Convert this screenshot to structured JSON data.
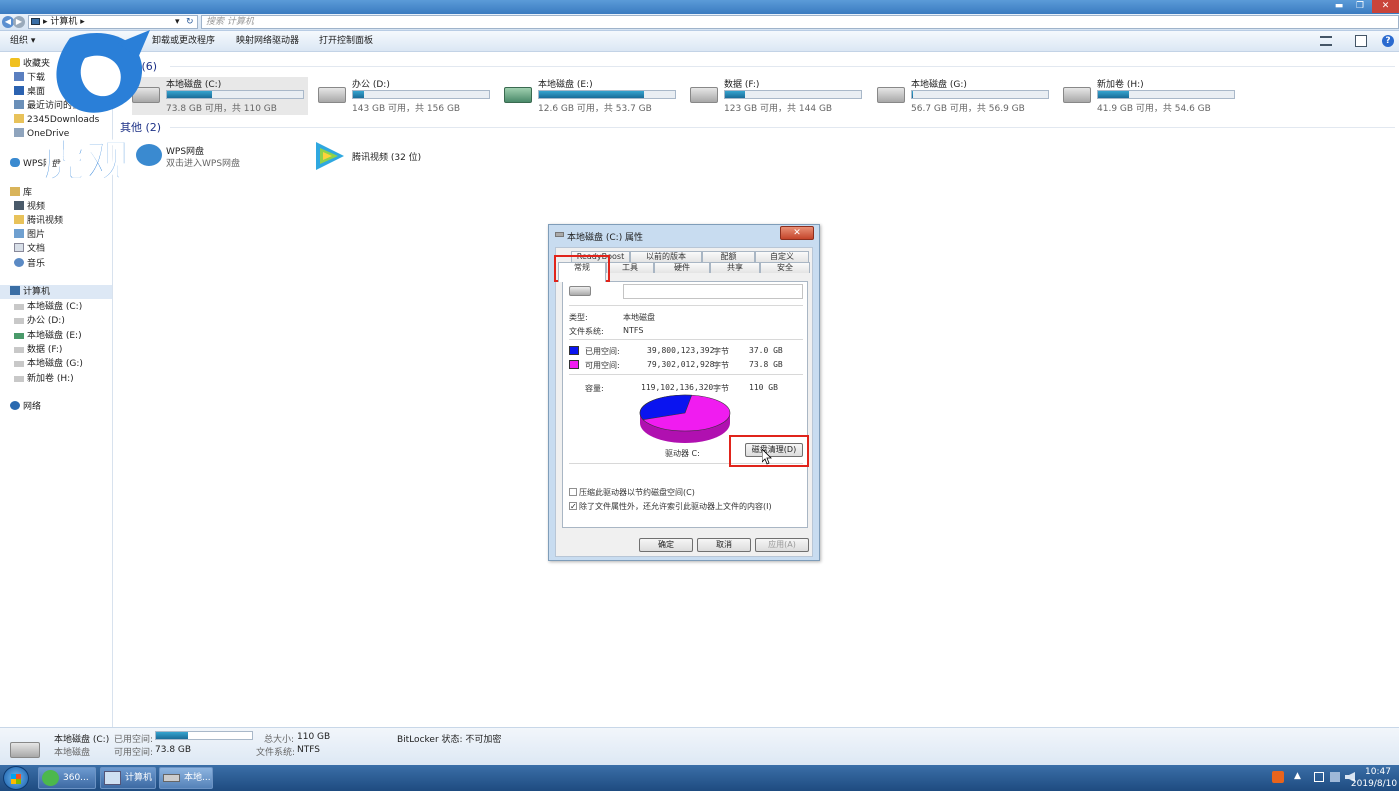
{
  "window": {
    "minimize": "▬",
    "maximize": "❐",
    "close": "✕"
  },
  "address": {
    "back": "◀",
    "forward": "▶",
    "path": "计算机",
    "sep1": "▸",
    "sep2": "▸",
    "dropdown": "▾",
    "refresh": "↻",
    "search_placeholder": "搜索 计算机"
  },
  "toolbar": {
    "organize": "组织 ▾",
    "uninstall": "卸载或更改程序",
    "map_drive": "映射网络驱动器",
    "control_panel": "打开控制面板",
    "help": "?"
  },
  "sidebar": {
    "favorites_label": "收藏夹",
    "favorites": [
      "下载",
      "桌面",
      "最近访问的位置",
      "2345Downloads",
      "OneDrive"
    ],
    "wps": "WPS网盘",
    "library_label": "库",
    "libraries": [
      "视频",
      "腾讯视频",
      "图片",
      "文档",
      "音乐"
    ],
    "computer_label": "计算机",
    "drives": [
      "本地磁盘 (C:)",
      "办公 (D:)",
      "本地磁盘 (E:)",
      "数据 (F:)",
      "本地磁盘 (G:)",
      "新加卷 (H:)"
    ],
    "network": "网络"
  },
  "main": {
    "section_drives": "硬盘 (6)",
    "section_other": "其他 (2)",
    "drives": [
      {
        "name": "本地磁盘 (C:)",
        "info": "73.8 GB 可用，共 110 GB",
        "used_fraction": 0.33
      },
      {
        "name": "办公 (D:)",
        "info": "143 GB 可用，共 156 GB",
        "used_fraction": 0.08
      },
      {
        "name": "本地磁盘 (E:)",
        "info": "12.6 GB 可用，共 53.7 GB",
        "used_fraction": 0.77
      },
      {
        "name": "数据 (F:)",
        "info": "123 GB 可用，共 144 GB",
        "used_fraction": 0.15
      },
      {
        "name": "本地磁盘 (G:)",
        "info": "56.7 GB 可用，共 56.9 GB",
        "used_fraction": 0.01
      },
      {
        "name": "新加卷 (H:)",
        "info": "41.9 GB 可用，共 54.6 GB",
        "used_fraction": 0.23
      }
    ],
    "other": [
      {
        "name": "WPS网盘",
        "sub": "双击进入WPS网盘"
      },
      {
        "name": "腾讯视频 (32 位)",
        "sub": ""
      }
    ]
  },
  "dialog": {
    "title": "本地磁盘 (C:) 属性",
    "close": "✕",
    "tabs_top": [
      "ReadyBoost",
      "以前的版本",
      "配额",
      "自定义"
    ],
    "tabs_bottom": [
      "常规",
      "工具",
      "硬件",
      "共享",
      "安全"
    ],
    "type_label": "类型:",
    "type_value": "本地磁盘",
    "fs_label": "文件系统:",
    "fs_value": "NTFS",
    "used_label": "已用空间:",
    "used_bytes": "39,800,123,392",
    "used_unit": "字节",
    "used_gb": "37.0 GB",
    "free_label": "可用空间:",
    "free_bytes": "79,302,012,928",
    "free_unit": "字节",
    "free_gb": "73.8 GB",
    "cap_label": "容量:",
    "cap_bytes": "119,102,136,320",
    "cap_unit": "字节",
    "cap_gb": "110 GB",
    "drive_label": "驱动器 C:",
    "cleanup_btn": "磁盘清理(D)",
    "compress": "压缩此驱动器以节约磁盘空间(C)",
    "index": "除了文件属性外，还允许索引此驱动器上文件的内容(I)",
    "ok": "确定",
    "cancel": "取消",
    "apply": "应用(A)",
    "used_fraction": 0.334,
    "colors": {
      "used": "#0a14f0",
      "free": "#f01cf0"
    }
  },
  "status": {
    "name": "本地磁盘 (C:)",
    "type": "本地磁盘",
    "used_label": "已用空间:",
    "free_label": "可用空间:",
    "free_value": "73.8 GB",
    "total_label": "总大小:",
    "total_value": "110 GB",
    "fs_label": "文件系统:",
    "fs_value": "NTFS",
    "bitlocker": "BitLocker 状态: 不可加密",
    "used_fraction": 0.33
  },
  "taskbar": {
    "app1": "360...",
    "app2": "计算机",
    "app3": "本地...",
    "time": "10:47",
    "date": "2019/8/10"
  },
  "logo_text": "虎观"
}
